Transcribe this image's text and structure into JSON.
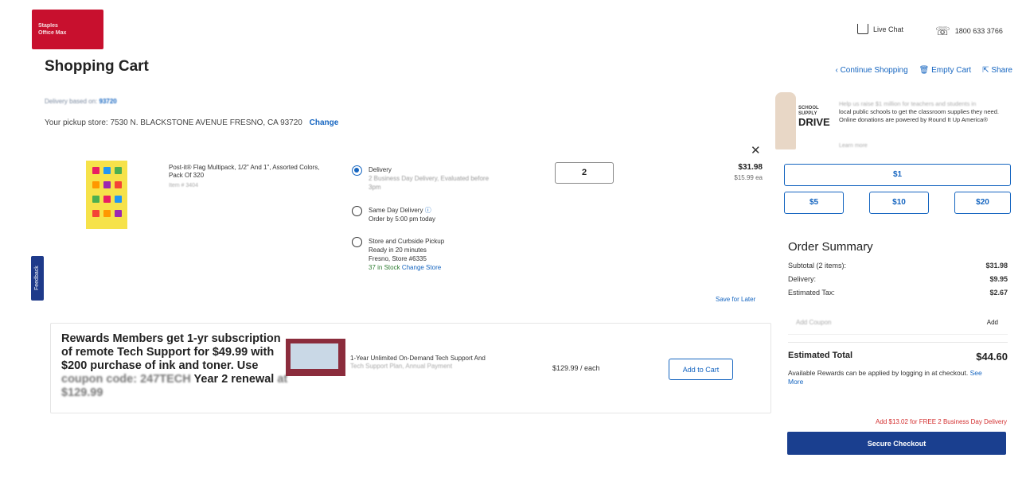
{
  "header": {
    "logo_text": [
      "Staples",
      "Office Max"
    ],
    "live_chat": "Live Chat",
    "phone": "1800 633 3766"
  },
  "page": {
    "title": "Shopping Cart"
  },
  "cart_links": {
    "continue": "Continue Shopping",
    "empty": "Empty Cart",
    "share": "Share"
  },
  "delivery_info": {
    "based_on_label": "Delivery based on:",
    "zip": "93720",
    "pickup_label": "Your pickup store:",
    "pickup_store": "7530 N. BLACKSTONE AVENUE FRESNO, CA 93720",
    "change": "Change"
  },
  "item": {
    "name": "Post-it® Flag Multipack, 1/2\" And 1\", Assorted Colors, Pack Of 320",
    "sub": "Item # 3404",
    "quantity": "2",
    "price": "$31.98",
    "each_price": "$15.99 ea",
    "save_for_later": "Save for Later",
    "options": {
      "delivery": {
        "title": "Delivery",
        "line1": "2 Business Day Delivery, Evaluated before",
        "line2": "3pm"
      },
      "same_day": {
        "title": "Same Day Delivery",
        "line1": "Order by 5:00 pm today"
      },
      "pickup": {
        "title": "Store and Curbside Pickup",
        "line1": "Ready in 20 minutes",
        "line2": "Fresno, Store #6335",
        "stock": "37 in Stock",
        "change_store": "Change Store"
      }
    }
  },
  "feedback_tab": {
    "label": "Feedback"
  },
  "promo": {
    "text_line1": "Rewards Members get 1-yr subscription of remote Tech Support for $49.99 with $200 purchase of ink and toner. Use",
    "coupon_blur": "coupon code: 247TECH",
    "text_line2": "Year 2 renewal",
    "renewal_blur": "at $129.99",
    "product_name": "1-Year Unlimited On-Demand Tech Support And",
    "product_name_blur": "Tech Support Plan, Annual Payment",
    "price": "$129.99 / each",
    "add_to_cart": "Add to Cart"
  },
  "school_drive": {
    "logo_small": [
      "SCHOOL",
      "SUPPLY"
    ],
    "logo_big": "DRIVE",
    "text_blur": "Help us raise $1 million for teachers and students in",
    "text": "local public schools to get the classroom supplies they need. Online donations are powered by Round It Up America®",
    "learn_more": "Learn more",
    "donations": [
      "$1",
      "$5",
      "$10",
      "$20"
    ]
  },
  "summary": {
    "title": "Order Summary",
    "rows": [
      {
        "label": "Subtotal (2 items):",
        "value": "$31.98"
      },
      {
        "label": "Delivery:",
        "value": "$9.95"
      },
      {
        "label": "Estimated Tax:",
        "value": "$2.67"
      }
    ],
    "promo_placeholder": "Add Coupon",
    "promo_add": "Add",
    "estimated_total_label": "Estimated Total",
    "estimated_total": "$44.60",
    "rewards_note": "Available Rewards can be applied by logging in at checkout.",
    "see_more": "See More",
    "free_shipping": "Add $13.02 for FREE 2 Business Day Delivery",
    "checkout": "Secure Checkout"
  },
  "colors": {
    "brand_red": "#c8102e",
    "link_blue": "#1565c0",
    "checkout_navy": "#1a3f8f",
    "stock_green": "#2e7d32"
  },
  "icons": [
    "chat-icon",
    "phone-icon",
    "chevron-left-icon",
    "trash-icon",
    "share-icon",
    "close-icon",
    "info-icon"
  ]
}
